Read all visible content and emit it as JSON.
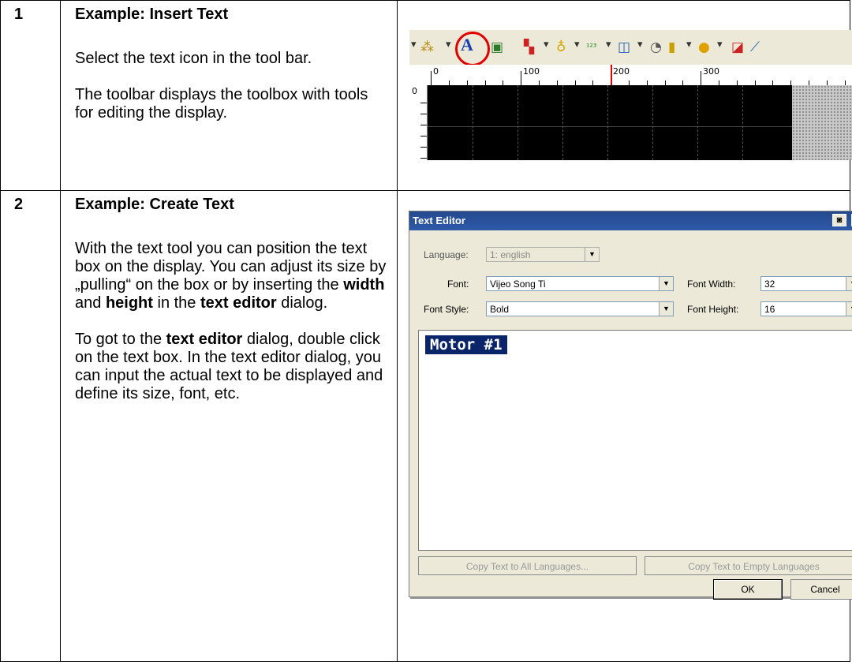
{
  "rows": [
    {
      "num": "1",
      "title": "Example:  Insert Text",
      "paragraphs": [
        "Select the text icon in the tool bar.",
        "The toolbar displays the toolbox with tools for editing the display."
      ],
      "ruler_labels": [
        "0",
        "100",
        "200",
        "300"
      ],
      "vruler_label": "0"
    },
    {
      "num": "2",
      "title": "Example: Create Text",
      "p1": [
        "With the text tool you can position the text box on the display. You can adjust its size by „pulling“ on the box or by inserting the ",
        "width",
        " and ",
        "height",
        " in the ",
        "text editor",
        " dialog."
      ],
      "p2": [
        "To got to the ",
        "text editor",
        " dialog, double click on the text box. In the text editor dialog, you can input the actual text to be displayed and define its size, font, etc."
      ]
    }
  ],
  "toolbar_icons": [
    "sparkle-icon",
    "text-icon",
    "bitmap-icon",
    "palette-icon",
    "lamp-icon",
    "numeric-icon",
    "window-icon",
    "gauge-icon",
    "bar-icon",
    "meter-icon",
    "picture-icon",
    "trend-icon"
  ],
  "dialog": {
    "title": "Text Editor",
    "language_label": "Language:",
    "language_value": "1: english",
    "font_label": "Font:",
    "font_value": "Vijeo Song Ti",
    "font_width_label": "Font Width:",
    "font_width_value": "32",
    "font_style_label": "Font Style:",
    "font_style_value": "Bold",
    "font_height_label": "Font Height:",
    "font_height_value": "16",
    "editor_text": "Motor #1",
    "copy_all_label": "Copy Text to All Languages...",
    "copy_empty_label": "Copy Text to Empty Languages",
    "ok_label": "OK",
    "cancel_label": "Cancel"
  },
  "colors": {
    "highlight_circle": "#e00000",
    "selection": "#0a246a",
    "title_bar": "#2e5aa8"
  }
}
